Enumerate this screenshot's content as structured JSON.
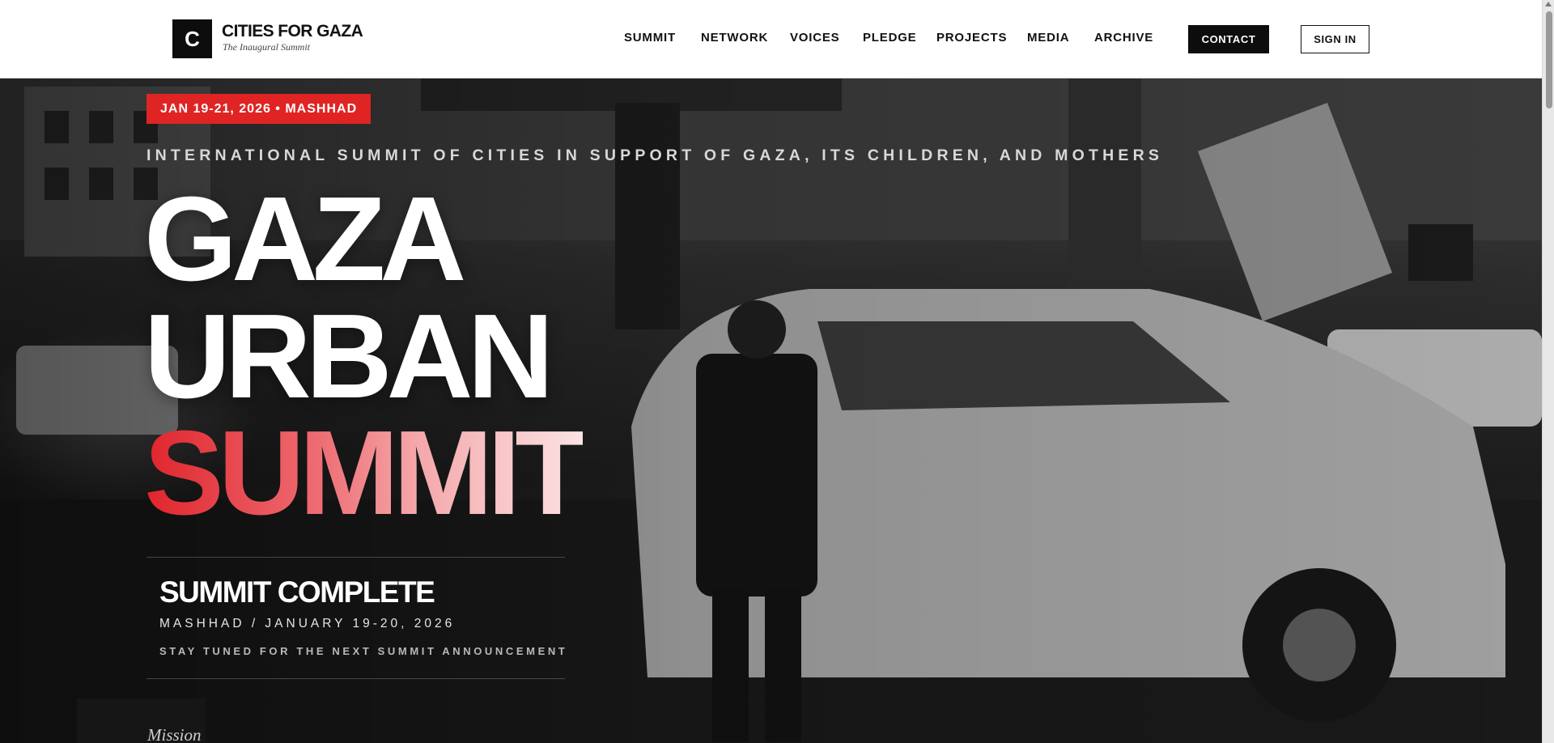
{
  "header": {
    "logo_letter": "C",
    "brand_title": "CITIES FOR GAZA",
    "brand_subtitle": "The Inaugural Summit",
    "nav": [
      "SUMMIT",
      "NETWORK",
      "VOICES",
      "PLEDGE",
      "PROJECTS",
      "MEDIA",
      "ARCHIVE"
    ],
    "contact_label": "CONTACT",
    "signin_label": "SIGN IN"
  },
  "hero": {
    "date_badge": "JAN 19-21, 2026 • MASHHAD",
    "kicker": "INTERNATIONAL SUMMIT OF CITIES IN SUPPORT OF GAZA, ITS CHILDREN, AND MOTHERS",
    "headline": [
      "GAZA",
      "URBAN",
      "SUMMIT"
    ],
    "status_title": "SUMMIT COMPLETE",
    "status_date": "MASHHAD / JANUARY 19-20, 2026",
    "status_note": "STAY TUNED FOR THE NEXT SUMMIT ANNOUNCEMENT",
    "mission_label": "Mission"
  },
  "colors": {
    "accent_red": "#e02424",
    "header_bg": "#ffffff",
    "button_dark": "#0d0d0d"
  }
}
